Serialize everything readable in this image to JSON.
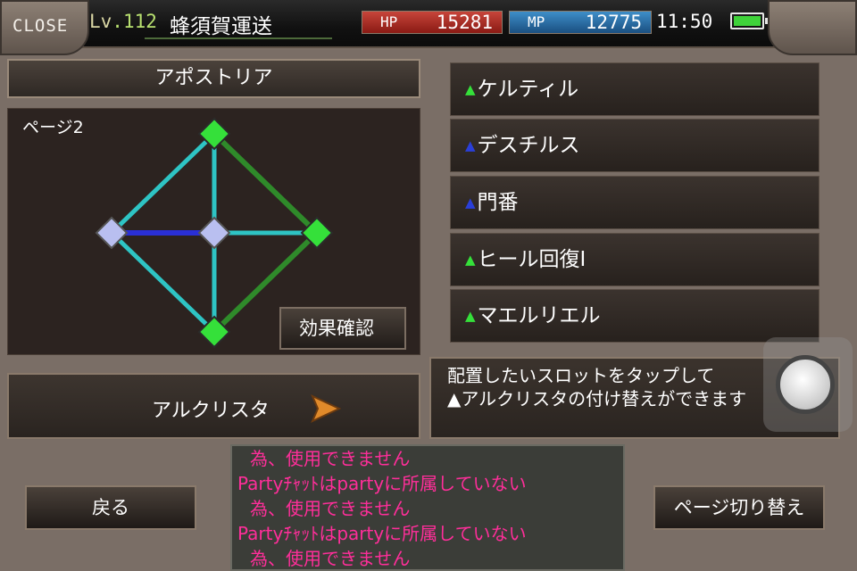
{
  "header": {
    "close_label": "CLOSE",
    "level_prefix": "Lv",
    "level_value": ".112",
    "player_name": "蜂須賀運送",
    "hp_label": "HP",
    "hp_value": "15281",
    "mp_label": "MP",
    "mp_value": "12775",
    "clock": "11:50"
  },
  "panel": {
    "title": "アポストリア",
    "page_label": "ページ2",
    "effect_button": "効果確認"
  },
  "slots": [
    {
      "label": "ケルティル",
      "marker": "▲",
      "marker_color": "#35e03a"
    },
    {
      "label": "デスチルス",
      "marker": "▲",
      "marker_color": "#2a3fd8"
    },
    {
      "label": "門番",
      "marker": "▲",
      "marker_color": "#2a3fd8"
    },
    {
      "label": "ヒール回復Ⅰ",
      "marker": "▲",
      "marker_color": "#35e03a"
    },
    {
      "label": "マエルリエル",
      "marker": "▲",
      "marker_color": "#35e03a"
    }
  ],
  "alcrysta_button": "アルクリスタ",
  "info": {
    "line1": "配置したいスロットをタップして",
    "line2": "▲アルクリスタの付け替えができます"
  },
  "buttons": {
    "back": "戻る",
    "page_switch": "ページ切り替え"
  },
  "chat": [
    "為、使用できません",
    "Partyﾁｬｯﾄはpartyに所属していない",
    "為、使用できません",
    "Partyﾁｬｯﾄはpartyに所属していない",
    "為、使用できません"
  ],
  "icons": {
    "arrow": "play-arrow-icon",
    "battery": "battery-icon",
    "joystick": "joystick-icon"
  },
  "colors": {
    "hp_bar": "#b3312a",
    "mp_bar": "#2e74b0",
    "node_green": "#35e03a",
    "node_lavender": "#b9bff0",
    "link_cyan": "#2ec4c4",
    "link_blue": "#2a2fd6",
    "link_dark_green": "#2f8a2a",
    "chat_text": "#ff2e9a"
  }
}
